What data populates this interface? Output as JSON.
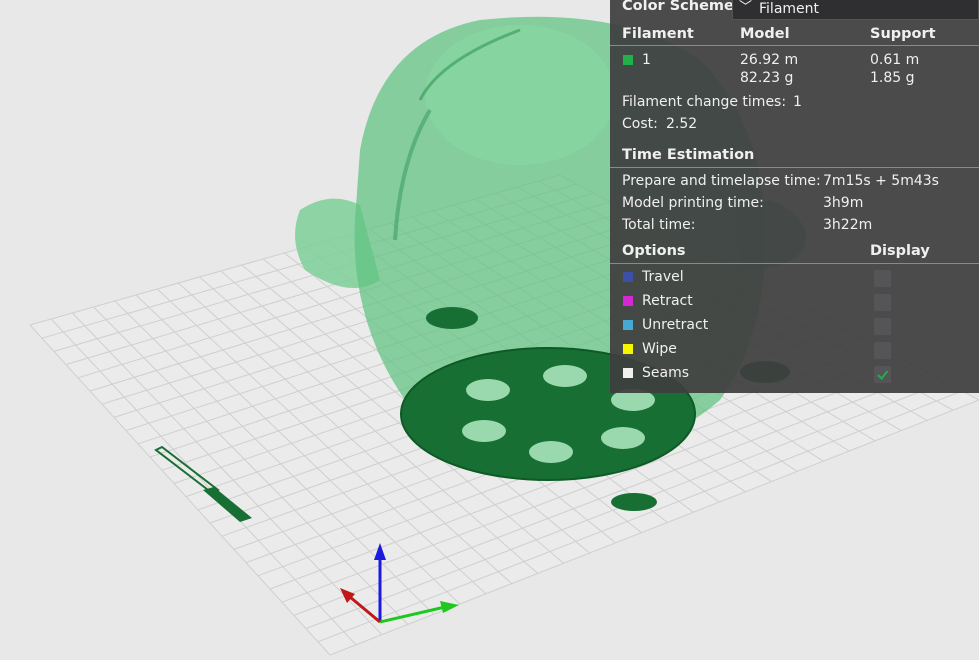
{
  "color_scheme": {
    "label": "Color Scheme",
    "value": "Filament",
    "chevron_icon": "chevron-down-icon"
  },
  "filament_table": {
    "headers": [
      "Filament",
      "Model",
      "Support"
    ],
    "rows": [
      {
        "swatch_color": "#21b14b",
        "id": "1",
        "model_length": "26.92 m",
        "model_weight": "82.23 g",
        "support_length": "0.61 m",
        "support_weight": "1.85 g"
      }
    ]
  },
  "filament_change": {
    "label": "Filament change times:",
    "value": "1"
  },
  "cost": {
    "label": "Cost:",
    "value": "2.52"
  },
  "time_estimation": {
    "title": "Time Estimation",
    "rows": [
      {
        "label": "Prepare and timelapse time:",
        "value": "7m15s + 5m43s"
      },
      {
        "label": "Model printing time:",
        "value": "3h9m"
      },
      {
        "label": "Total time:",
        "value": "3h22m"
      }
    ]
  },
  "options": {
    "headers": [
      "Options",
      "Display"
    ],
    "items": [
      {
        "label": "Travel",
        "color": "#3d4fa6",
        "checked": false
      },
      {
        "label": "Retract",
        "color": "#d428d4",
        "checked": false
      },
      {
        "label": "Unretract",
        "color": "#45a9d1",
        "checked": false
      },
      {
        "label": "Wipe",
        "color": "#f5f500",
        "checked": false
      },
      {
        "label": "Seams",
        "color": "#f0f0f0",
        "checked": true
      }
    ]
  },
  "viewport": {
    "model_color": "#22a04e",
    "bed_color": "#e8e8e8",
    "grid_color": "#cfcfcf",
    "axis_colors": {
      "x": "#c01818",
      "y": "#1ec81e",
      "z": "#1a1ae0"
    }
  }
}
